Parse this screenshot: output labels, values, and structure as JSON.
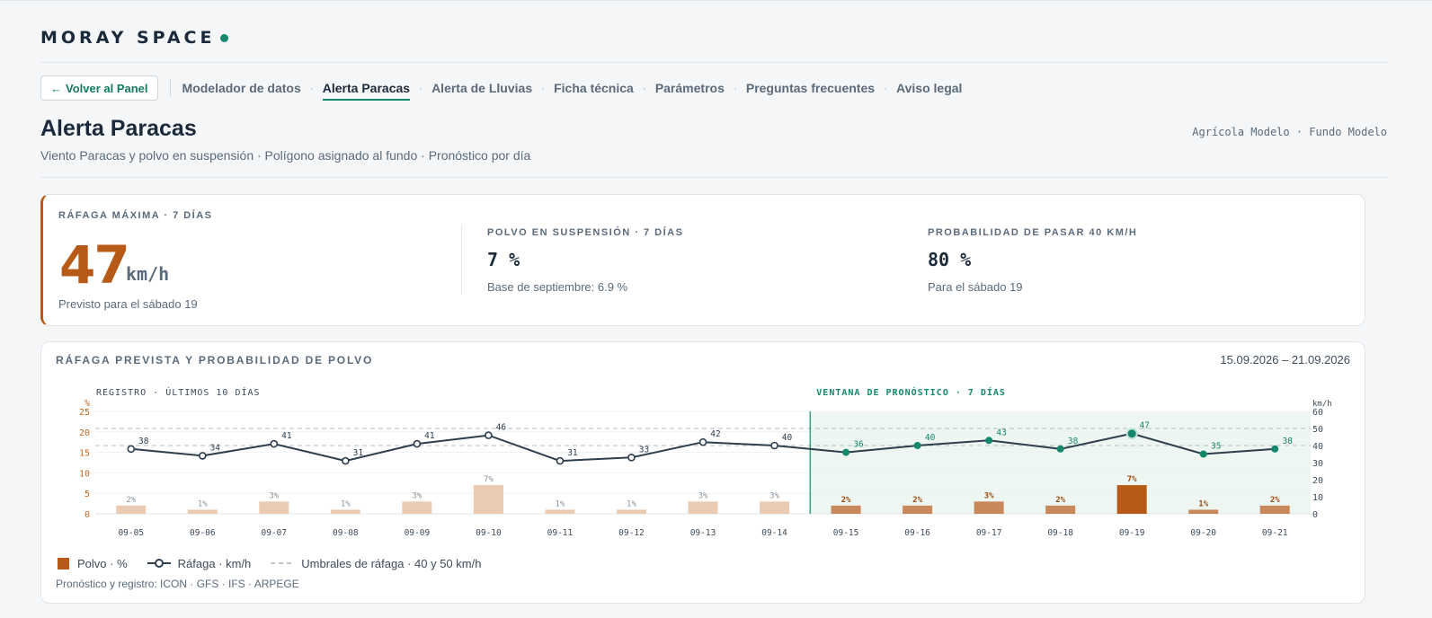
{
  "brand": {
    "name": "MORAY SPACE",
    "dot_color": "#15876a"
  },
  "nav": {
    "back_label": "Volver al Panel",
    "items": [
      {
        "label": "Modelador de datos",
        "active": false
      },
      {
        "label": "Alerta Paracas",
        "active": true
      },
      {
        "label": "Alerta de Lluvias",
        "active": false
      },
      {
        "label": "Ficha técnica",
        "active": false
      },
      {
        "label": "Parámetros",
        "active": false
      },
      {
        "label": "Preguntas frecuentes",
        "active": false
      },
      {
        "label": "Aviso legal",
        "active": false
      }
    ],
    "separator": "·"
  },
  "page": {
    "title": "Alerta Paracas",
    "subtitle": "Viento Paracas y polvo en suspensión · Polígono asignado al fundo · Pronóstico por día",
    "org": "Agrícola Modelo · Fundo Modelo"
  },
  "kpis": {
    "gust": {
      "label": "RÁFAGA MÁXIMA · 7 DÍAS",
      "value": "47",
      "unit": "km/h",
      "note": "Previsto para el sábado 19"
    },
    "dust": {
      "label": "POLVO EN SUSPENSIÓN · 7 DÍAS",
      "value": "7 %",
      "note": "Base de septiembre: 6.9 %"
    },
    "prob": {
      "label": "PROBABILIDAD DE PASAR 40 KM/H",
      "value": "80 %",
      "note": "Para el sábado 19"
    }
  },
  "chart_card": {
    "title": "RÁFAGA PREVISTA Y PROBABILIDAD DE POLVO",
    "date_range": "15.09.2026 – 21.09.2026",
    "legend": {
      "dust": "Polvo · %",
      "gust": "Ráfaga · km/h",
      "thresholds": "Umbrales de ráfaga · 40 y 50 km/h"
    },
    "sources": "Pronóstico y registro: ICON · GFS · IFS · ARPEGE"
  },
  "chart_data": {
    "type": "bar",
    "categories": [
      "09-05",
      "09-06",
      "09-07",
      "09-08",
      "09-09",
      "09-10",
      "09-11",
      "09-12",
      "09-13",
      "09-14",
      "09-15",
      "09-16",
      "09-17",
      "09-18",
      "09-19",
      "09-20",
      "09-21"
    ],
    "series": [
      {
        "name": "Polvo · %",
        "type": "bar",
        "axis": "left",
        "values": [
          2,
          1,
          3,
          1,
          3,
          7,
          1,
          1,
          3,
          3,
          2,
          2,
          3,
          2,
          7,
          1,
          2
        ],
        "labels": [
          "2%",
          "1%",
          "3%",
          "1%",
          "3%",
          "7%",
          "1%",
          "1%",
          "3%",
          "3%",
          "2%",
          "2%",
          "3%",
          "2%",
          "7%",
          "1%",
          "2%"
        ]
      },
      {
        "name": "Ráfaga · km/h",
        "type": "line",
        "axis": "right",
        "values": [
          38,
          34,
          41,
          31,
          41,
          46,
          31,
          33,
          42,
          40,
          36,
          40,
          43,
          38,
          47,
          35,
          38
        ]
      }
    ],
    "thresholds": [
      40,
      50
    ],
    "left_axis": {
      "label": "%",
      "ticks": [
        0,
        5,
        10,
        15,
        20,
        25
      ],
      "range": [
        0,
        25
      ]
    },
    "right_axis": {
      "label": "km/h",
      "ticks": [
        0,
        10,
        20,
        30,
        40,
        50,
        60
      ],
      "range": [
        0,
        60
      ]
    },
    "regions": [
      {
        "label": "REGISTRO · ÚLTIMOS 10 DÍAS",
        "from": "09-05",
        "to": "09-14"
      },
      {
        "label": "VENTANA DE PRONÓSTICO · 7 DÍAS",
        "from": "09-15",
        "to": "09-21"
      }
    ],
    "highlight": "09-19",
    "colors": {
      "past_bar": "#ebcab2",
      "forecast_bar": "#c8885a",
      "peak_bar": "#b85a17",
      "line": "#2e3e4e",
      "forecast_point": "#15876a",
      "forecast_bg": "#eef6f2",
      "threshold": "#b4bcc4"
    }
  }
}
